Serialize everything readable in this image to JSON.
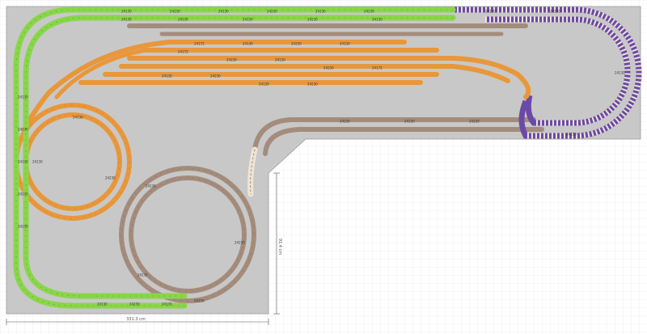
{
  "plan": {
    "colors": {
      "grid_bg": "#ffffff",
      "grid_line": "#e6e6ea",
      "board": "#c8c8c8",
      "board_edge": "#9a9a9a",
      "green_track": "#8ad64a",
      "green_rail": "#3f8f1a",
      "orange_track": "#e8973a",
      "orange_rail": "#b86d1c",
      "grey_track": "#a48c7c",
      "grey_rail": "#6e5e54",
      "purple_track": "#6a4aa6",
      "purple_rail": "#3f2a74",
      "ballast_light": "#efe4d6"
    },
    "dimensions": {
      "width_label": "331.3 cm",
      "height_label": "91.4 cm"
    },
    "track_labels": {
      "green": [
        "24130",
        "24230",
        "24130",
        "24230",
        "24130",
        "24230",
        "24130",
        "24230",
        "24130",
        "24230",
        "24230",
        "24130",
        "24230",
        "24130"
      ],
      "orange": [
        "24172",
        "24130",
        "24230",
        "24130",
        "24172",
        "24230",
        "24130",
        "24230",
        "24172",
        "24130",
        "24230",
        "24130",
        "24230",
        "24130",
        "24230",
        "24130"
      ],
      "grey": [
        "24130",
        "24230",
        "24130",
        "24230",
        "24130",
        "24230",
        "24130",
        "24230",
        "24130",
        "24230",
        "24130",
        "24230"
      ],
      "purple": [
        "24130",
        "24230",
        "24130",
        "24230"
      ]
    }
  }
}
